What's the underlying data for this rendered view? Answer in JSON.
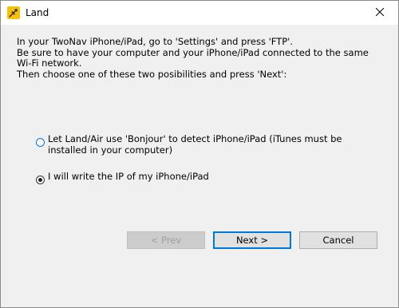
{
  "window": {
    "title": "Land"
  },
  "intro": {
    "lines": [
      "In your TwoNav iPhone/iPad, go to 'Settings' and press 'FTP'.",
      "Be sure to have your computer and your iPhone/iPad connected to the same",
      "Wi-Fi network.",
      "Then choose one of these two posibilities and press 'Next':"
    ]
  },
  "options": [
    {
      "label": "Let Land/Air use 'Bonjour' to detect iPhone/iPad (iTunes must be installed in your computer)",
      "selected": false
    },
    {
      "label": "I will write the IP of my iPhone/iPad",
      "selected": true
    }
  ],
  "buttons": {
    "prev": "< Prev",
    "next": "Next >",
    "cancel": "Cancel"
  },
  "colors": {
    "accent": "#0078d7"
  },
  "icons": {
    "app": "land-app-icon",
    "close": "close-icon"
  }
}
